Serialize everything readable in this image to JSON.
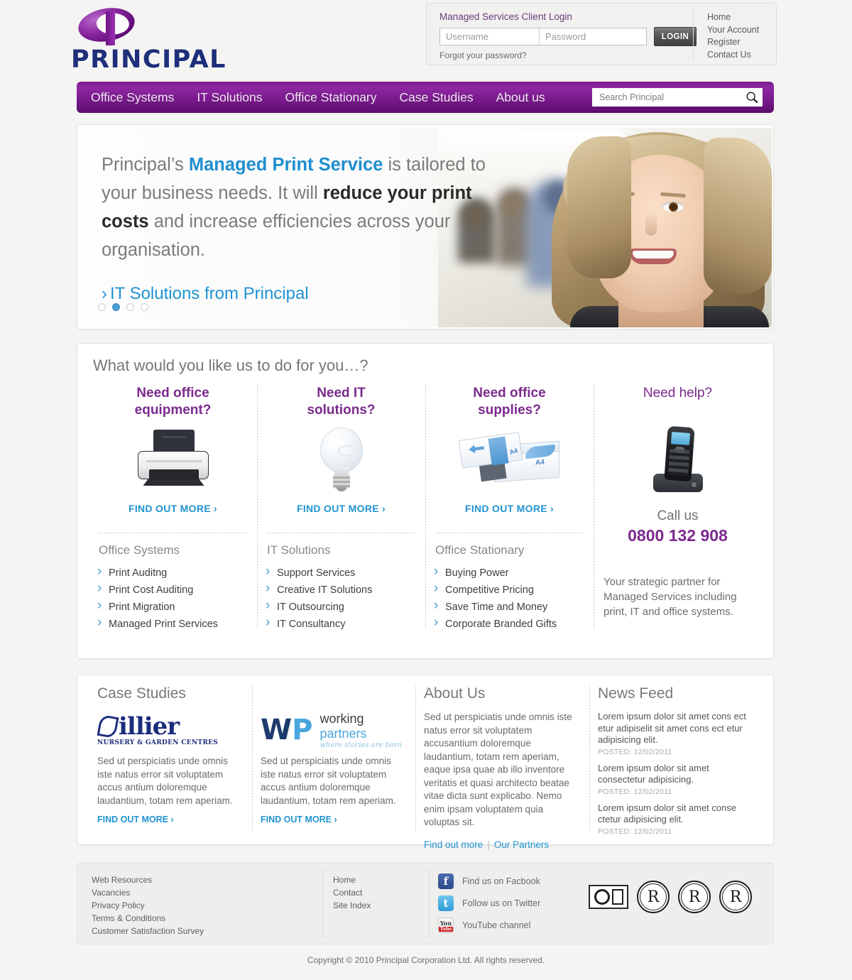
{
  "brand": {
    "name": "PRINCIPAL",
    "logo_icon": "principal-p-logo"
  },
  "login": {
    "title": "Managed Services Client Login",
    "username_placeholder": "Username",
    "password_placeholder": "Password",
    "username_value": "",
    "password_value": "",
    "button_label": "LOGIN",
    "forgot_label": "Forgot your password?"
  },
  "header_links": [
    "Home",
    "Your Account",
    "Register",
    "Contact Us"
  ],
  "nav": {
    "items": [
      "Office Systems",
      "IT Solutions",
      "Office Stationary",
      "Case Studies",
      "About us"
    ],
    "search_placeholder": "Search Principal",
    "search_value": "",
    "search_icon": "magnifier-icon",
    "accent_color": "#7b1b8e"
  },
  "hero": {
    "line1_a": "Principal’s ",
    "line1_b": "Managed Print Service",
    "line1_c": " is tailored",
    "line2_a": "to your business needs. It will ",
    "line2_b": "reduce your",
    "line3_a": "print costs",
    "line3_b": " and increase efficiencies across",
    "line4": "your organisation.",
    "cta": "IT Solutions from Principal",
    "cta_chevron": "›",
    "highlight_color": "#1f8fd0",
    "slides_total": 4,
    "active_slide": 2
  },
  "services": {
    "title": "What would you like us to do for you…?",
    "columns": [
      {
        "heading_l1": "Need office",
        "heading_l2": "equipment?",
        "icon": "printer-icon",
        "cta": "FIND OUT MORE ›",
        "sub_heading": "Office Systems",
        "links": [
          "Print Auditng",
          "Print Cost Auditing",
          "Print Migration",
          "Managed Print Services"
        ]
      },
      {
        "heading_l1": "Need IT",
        "heading_l2": "solutions?",
        "icon": "lightbulb-icon",
        "cta": "FIND OUT MORE ›",
        "sub_heading": "IT Solutions",
        "links": [
          "Support Services",
          "Creative IT Solutions",
          "IT Outsourcing",
          "IT Consultancy"
        ]
      },
      {
        "heading_l1": "Need office",
        "heading_l2": "supplies?",
        "icon": "paper-box-icon",
        "cta": "FIND OUT MORE ›",
        "sub_heading": "Office Stationary",
        "links": [
          "Buying Power",
          "Competitive Pricing",
          "Save Time and Money",
          "Corporate Branded Gifts"
        ]
      }
    ],
    "help": {
      "heading": "Need help?",
      "icon": "cordless-phone-icon",
      "call_label": "Call us",
      "phone": "0800 132 908",
      "blurb": "Your strategic partner for Managed Services including print, IT and office systems."
    }
  },
  "case_studies": {
    "title": "Case Studies",
    "items": [
      {
        "logo": "hillier-logo",
        "logo_main": "illier",
        "logo_sub": "NURSERY & GARDEN CENTRES",
        "body": "Sed ut perspiciatis unde omnis iste natus error sit voluptatem accus antium doloremque laudantium, totam rem aperiam.",
        "cta": "FIND OUT MORE ›"
      },
      {
        "logo": "working-partners-logo",
        "logo_mark_w": "W",
        "logo_mark_p": "P",
        "logo_main_a": "working ",
        "logo_main_b": "partners",
        "logo_tag": "where stories are born",
        "body": "Sed ut perspiciatis unde omnis iste natus error sit voluptatem accus antium doloremque laudantium, totam rem aperiam.",
        "cta": "FIND OUT MORE ›"
      }
    ]
  },
  "about": {
    "title": "About Us",
    "body": "Sed ut perspiciatis unde omnis iste natus error sit voluptatem accusantium doloremque laudantium, totam rem aperiam, eaque ipsa quae ab illo inventore veritatis et quasi architecto beatae vitae dicta sunt explicabo. Nemo enim ipsam voluptatem quia voluptas sit.",
    "link1": "Find out more",
    "divider": "|",
    "link2": "Our Partners"
  },
  "news": {
    "title": "News Feed",
    "items": [
      {
        "text": "Lorem ipsum dolor sit amet cons ect etur adipiselit sit amet cons ect etur adipisicing elit.",
        "posted": "POSTED: 12/02/2011"
      },
      {
        "text": "Lorem ipsum dolor sit amet consectetur adipisicing.",
        "posted": "POSTED: 12/02/2011"
      },
      {
        "text": "Lorem ipsum dolor sit amet conse ctetur adipisicing elit.",
        "posted": "POSTED: 12/02/2011"
      }
    ]
  },
  "footer": {
    "column1": [
      "Web Resources",
      "Vacancies",
      "Privacy Policy",
      "Terms & Conditions",
      "Customer Satisfaction Survey"
    ],
    "column2": [
      "Home",
      "Contact",
      "Site Index"
    ],
    "socials": [
      {
        "icon": "facebook-icon",
        "glyph": "f",
        "label": "Find us on Facbook"
      },
      {
        "icon": "twitter-icon",
        "glyph": "t",
        "label": "Follow us on Twitter"
      },
      {
        "icon": "youtube-icon",
        "glyph": "You",
        "glyph2": "Tube",
        "label": "YouTube channel"
      }
    ],
    "certifications": [
      "bsi-kitemark-badge",
      "lloyds-register-quality-assurance-badge",
      "lloyds-register-quality-assurance-badge",
      "lloyds-register-quality-assurance-badge"
    ],
    "cert_letter": "R"
  },
  "copyright": "Copyright © 2010 Principal Corporation Ltd. All rights reserved."
}
